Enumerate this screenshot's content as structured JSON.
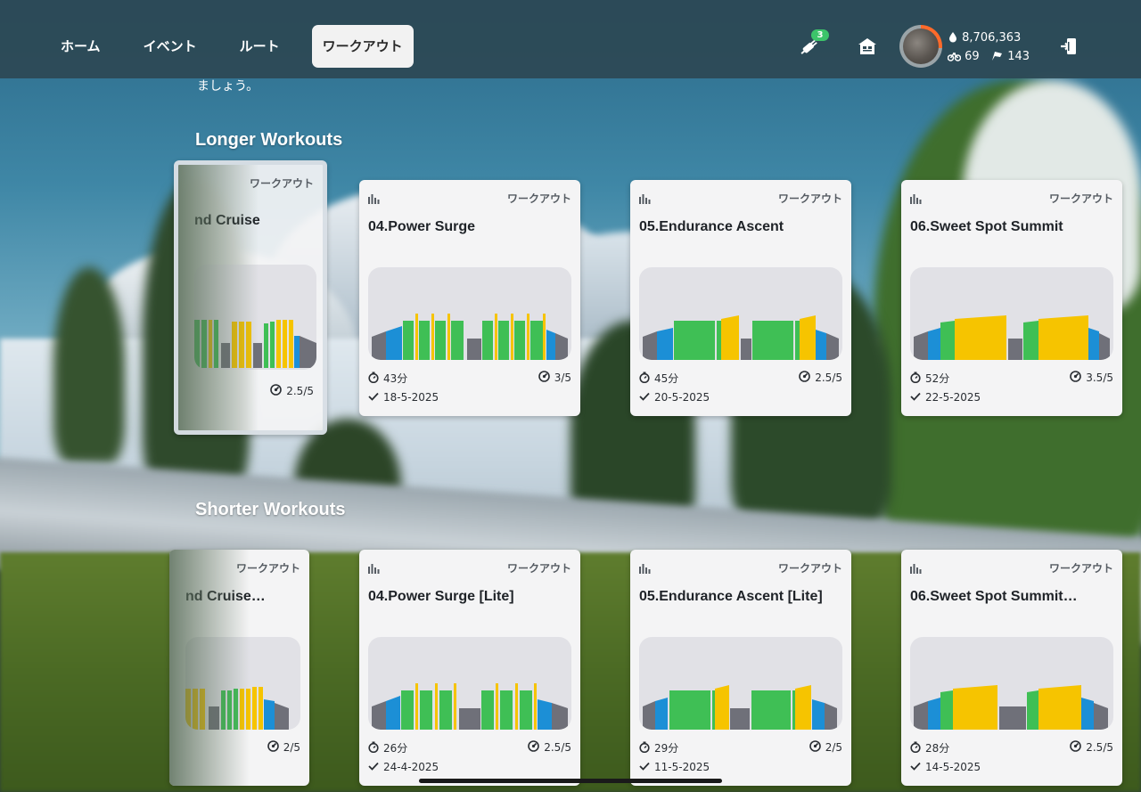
{
  "nav": {
    "tabs": [
      {
        "label": "ホーム",
        "active": false
      },
      {
        "label": "イベント",
        "active": false
      },
      {
        "label": "ルート",
        "active": false
      },
      {
        "label": "ワークアウト",
        "active": true
      }
    ]
  },
  "header": {
    "plug_badge": "3",
    "drops": "8,706,363",
    "level": "69",
    "routes": "143",
    "icons": [
      "plug-icon",
      "home-icon",
      "avatar",
      "drop-icon",
      "bike-icon",
      "flag-icon",
      "logout-icon"
    ]
  },
  "intro_text": "ましょう。",
  "sections": {
    "longer": "Longer Workouts",
    "shorter": "Shorter Workouts"
  },
  "cards": {
    "longer": [
      {
        "type": "ワークアウト",
        "title": "nd Cruise",
        "duration": "",
        "difficulty": "2.5/5",
        "date": "",
        "partial": true
      },
      {
        "type": "ワークアウト",
        "title": "04.Power Surge",
        "duration": "43分",
        "difficulty": "3/5",
        "date": "18-5-2025"
      },
      {
        "type": "ワークアウト",
        "title": "05.Endurance Ascent",
        "duration": "45分",
        "difficulty": "2.5/5",
        "date": "20-5-2025"
      },
      {
        "type": "ワークアウト",
        "title": "06.Sweet Spot Summit",
        "duration": "52分",
        "difficulty": "3.5/5",
        "date": "22-5-2025"
      }
    ],
    "shorter": [
      {
        "type": "ワークアウト",
        "title": "nd Cruise…",
        "duration": "",
        "difficulty": "2/5",
        "date": "",
        "partial": true
      },
      {
        "type": "ワークアウト",
        "title": "04.Power Surge [Lite]",
        "duration": "26分",
        "difficulty": "2.5/5",
        "date": "24-4-2025"
      },
      {
        "type": "ワークアウト",
        "title": "05.Endurance Ascent [Lite]",
        "duration": "29分",
        "difficulty": "2/5",
        "date": "11-5-2025"
      },
      {
        "type": "ワークアウト",
        "title": "06.Sweet Spot Summit…",
        "duration": "28分",
        "difficulty": "2.5/5",
        "date": "14-5-2025"
      }
    ]
  },
  "colors": {
    "gray": "#6f7079",
    "blue": "#1c8fd6",
    "green": "#3fbf55",
    "yellow": "#f6c400",
    "card_bg": "#f4f4f5",
    "chart_bg": "#e1e1e6",
    "active_tab_bg": "#f2f2f2",
    "topbar": "#2d4854"
  }
}
